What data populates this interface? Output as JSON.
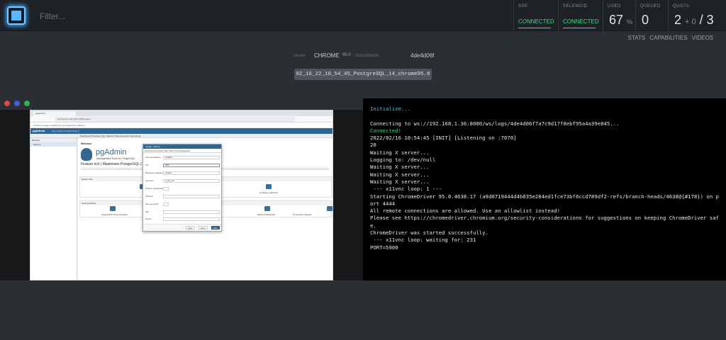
{
  "header": {
    "filter_placeholder": "Filter...",
    "stats": {
      "sse": {
        "label": "SSE",
        "value": "CONNECTED"
      },
      "selenoid": {
        "label": "SELENOID",
        "value": "CONNECTED"
      },
      "used": {
        "label": "USED",
        "value": "67",
        "unit": "%"
      },
      "queued": {
        "label": "QUEUED",
        "value": "0"
      },
      "quota": {
        "label": "QUOTA",
        "left": "2",
        "mid": "+ 0",
        "right": "/ 3"
      }
    },
    "colors": {
      "connected": "#3ddc84",
      "accent": "#2f9cf0"
    }
  },
  "subnav": {
    "stats": "STATS",
    "capabilities": "CAPABILITIES",
    "videos": "VIDEOS"
  },
  "session": {
    "platform": "chrome",
    "browser": "CHROME",
    "version": "95.0",
    "resolution": "1920x1080x24",
    "id": "4de4d06f",
    "video_name": "02_16_22_10_54_45_PostgreSQL_14_chrome95.0"
  },
  "vnc": {
    "tab_title": "pgAdmin 4",
    "url": "Not secure | 192.168.1.36/browser/",
    "notice": "Chrome is being controlled by automated test software.",
    "app_logo": "pgAdmin",
    "nav": "File ▾   Object ▾   Tools ▾   Help ▾",
    "tabs": "Dashboard   Properties   SQL   Statistics   Dependencies   Dependents",
    "tree_header": "Browser",
    "tree_item": "Servers",
    "welcome": "Welcome",
    "title": "pgAdmin",
    "subtitle": "Management Tools for PostgreSQL",
    "feature": "Feature rich | Maximises PostgreSQL | Op",
    "quick_links": "Quick Links",
    "configure": "Configure pgAdmin",
    "getting_started": "Getting Started",
    "links": [
      "PostgreSQL Documentation",
      "pgAdmin Website",
      "Planet PostgreSQL",
      "Community Support"
    ],
    "dialog": {
      "title": "Create - Server",
      "tabs": "General   Connection   SSL   SSH Tunnel   Advanced",
      "rows": [
        {
          "label": "Host name/address",
          "value": "localhost"
        },
        {
          "label": "Port",
          "value": "5432"
        },
        {
          "label": "Maintenance database",
          "value": "postgres"
        },
        {
          "label": "Username",
          "value": "q_test_user"
        },
        {
          "label": "Kerberos authentication?",
          "value": ""
        },
        {
          "label": "Password",
          "value": ""
        },
        {
          "label": "Save password?",
          "value": ""
        },
        {
          "label": "Role",
          "value": ""
        },
        {
          "label": "Service",
          "value": ""
        }
      ],
      "close": "Close",
      "reset": "Reset",
      "save": "Save"
    }
  },
  "log": {
    "lines": [
      {
        "text": "Initialize...",
        "style": "cyan"
      },
      {
        "text": "",
        "style": ""
      },
      {
        "text": "Connecting to ws://192.168.1.36:8080/ws/logs/4de4d06f7a7c9d17f8ebf95a4a39e845...",
        "style": ""
      },
      {
        "text": "Connected!",
        "style": "green"
      },
      {
        "text": "2022/02/16 10:54:45 [INIT] [Listening on :7070]",
        "style": ""
      },
      {
        "text": "20",
        "style": ""
      },
      {
        "text": "Waiting X server...",
        "style": ""
      },
      {
        "text": "Logging to: /dev/null",
        "style": ""
      },
      {
        "text": "Waiting X server...",
        "style": ""
      },
      {
        "text": "Waiting X server...",
        "style": ""
      },
      {
        "text": "Waiting X server...",
        "style": ""
      },
      {
        "text": " --- x11vnc loop: 1 ---",
        "style": ""
      },
      {
        "text": "Starting ChromeDriver 95.0.4638.17 (a9d0719444d4b035e284ed1fce73bf6ccd789df2-refs/branch-heads/4638@{#178}) on p",
        "style": ""
      },
      {
        "text": "ort 4444",
        "style": ""
      },
      {
        "text": "All remote connections are allowed. Use an allowlist instead!",
        "style": ""
      },
      {
        "text": "Please see https://chromedriver.chromium.org/security-considerations for suggestions on keeping ChromeDriver saf",
        "style": ""
      },
      {
        "text": "e.",
        "style": ""
      },
      {
        "text": "ChromeDriver was started successfully.",
        "style": ""
      },
      {
        "text": " --- x11vnc loop: waiting for: 231",
        "style": ""
      },
      {
        "text": "PORT=5900",
        "style": ""
      }
    ]
  }
}
